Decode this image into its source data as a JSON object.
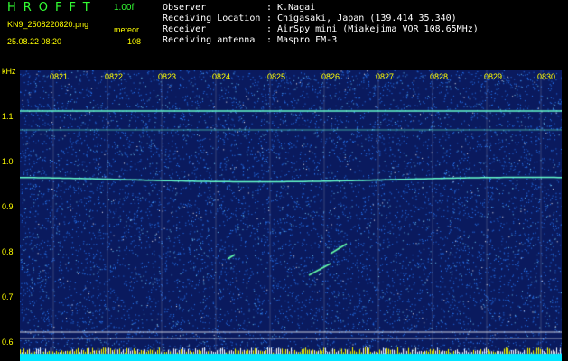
{
  "header": {
    "logo": "HROFFT",
    "version": "1.00f",
    "filename": "KN9_2508220820.png",
    "type": "meteor",
    "datetime": "25.08.22 08:20",
    "count": "108"
  },
  "meta": [
    {
      "key": "Observer",
      "value": "K.Nagai"
    },
    {
      "key": "Receiving Location",
      "value": "Chigasaki, Japan (139.414 35.340)"
    },
    {
      "key": "Receiver",
      "value": "AirSpy mini (Miakejima VOR 108.65MHz)"
    },
    {
      "key": "Receiving antenna",
      "value": "Maspro FM-3"
    }
  ],
  "spectrogram": {
    "y_unit": "kHz",
    "y_ticks": [
      "1.1",
      "1.0",
      "0.9",
      "0.8",
      "0.7",
      "0.6"
    ],
    "y_range": [
      0.58,
      1.17
    ],
    "time_ticks": [
      "0821",
      "0822",
      "0823",
      "0824",
      "0825",
      "0826",
      "0827",
      "0828",
      "0829",
      "0830"
    ],
    "colors": {
      "background": "#0a1a5e",
      "noise": "#2a7fff",
      "carrier": "#66ffcc",
      "label": "#ffff00",
      "logo": "#33ff33"
    }
  }
}
